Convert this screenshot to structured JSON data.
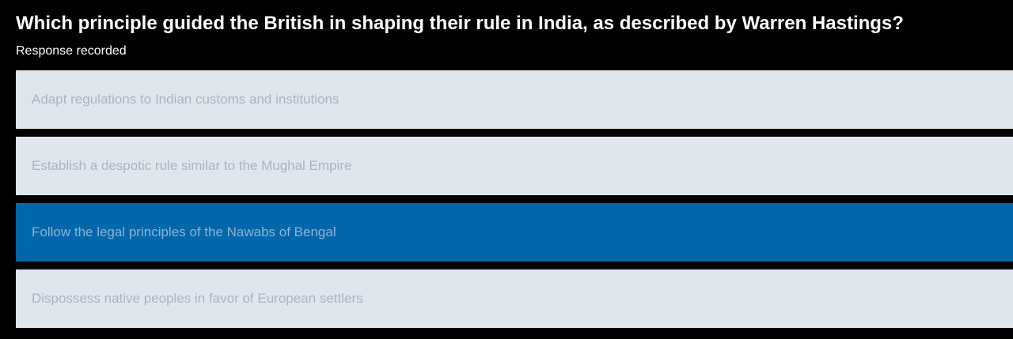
{
  "question": {
    "text": "Which principle guided the British in shaping their rule in India, as described by Warren Hastings?",
    "status": "Response recorded"
  },
  "options": [
    {
      "label": "Adapt regulations to Indian customs and institutions",
      "selected": false
    },
    {
      "label": "Establish a despotic rule similar to the Mughal Empire",
      "selected": false
    },
    {
      "label": "Follow the legal principles of the Nawabs of Bengal",
      "selected": true
    },
    {
      "label": "Dispossess native peoples in favor of European settlers",
      "selected": false
    }
  ],
  "colors": {
    "background": "#000000",
    "option_default": "#dfe6ee",
    "option_selected": "#0166aa",
    "option_text": "#a9b3bf",
    "option_selected_text": "#8fb3d3"
  }
}
